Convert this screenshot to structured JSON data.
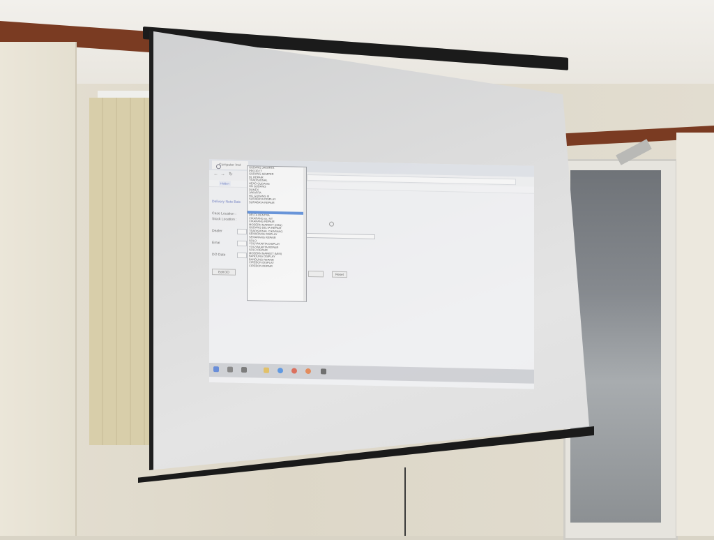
{
  "browser": {
    "tab_title": "Computer Inst",
    "address_text": "",
    "bookmark_label": "Hidden"
  },
  "page": {
    "title": "",
    "form_heading": "Delivery Note Batc",
    "labels": [
      "Case Location :",
      "Stock Location :",
      "Dealer",
      "Emai",
      "DO Date"
    ],
    "hint_text": "",
    "buttons": [
      "Edit DO",
      "Reset"
    ]
  },
  "dropdown": {
    "selected_index": 14,
    "items": [
      "GUDANG JAKARTA",
      "PROJECT",
      "GUDANG SEMPER",
      "DL REPAIR",
      "TRADISIONAL",
      "HEAD GUDANG",
      "HN GUDANG",
      "DUNEX",
      "JAKARTA",
      "HG GUDANG III",
      "SURABAYA DISPLAY",
      "SURABAYA REPAIR",
      "",
      "",
      "",
      "DELTA DENTRA",
      "CIKARANG ex. MT",
      "CIKARANG REPAIR",
      "MODERN MARKET (CBN)",
      "GUDANG DELTA REPAIR",
      "TRADISIONAL CIKARANG",
      "SEMARANG DISPLAY",
      "SEMARANG REPAIR",
      "SOLO",
      "YOGYAKARTA DISPLAY",
      "YOGYAKARTA REPAIR",
      "SOLO REPAIR",
      "MODERN MARKET (MMI)",
      "BANDUNG DISPLAY",
      "BANDUNG REPAIR",
      "CIREBON DISPLAY",
      "CIREBON REPAIR"
    ]
  },
  "taskbar": {
    "icons": [
      "windows-icon",
      "search-icon",
      "task-view-icon",
      "file-explorer-icon",
      "edge-icon",
      "chrome-icon",
      "firefox-icon",
      "app-icon"
    ]
  }
}
